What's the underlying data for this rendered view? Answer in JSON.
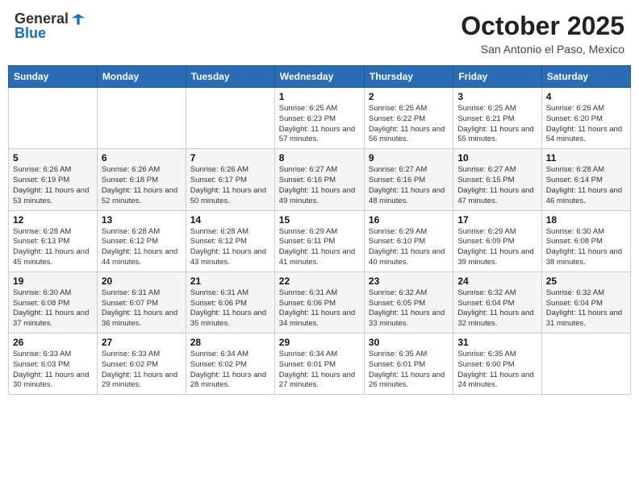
{
  "header": {
    "logo_general": "General",
    "logo_blue": "Blue",
    "month_title": "October 2025",
    "location": "San Antonio el Paso, Mexico"
  },
  "days_of_week": [
    "Sunday",
    "Monday",
    "Tuesday",
    "Wednesday",
    "Thursday",
    "Friday",
    "Saturday"
  ],
  "weeks": [
    [
      {
        "day": "",
        "info": ""
      },
      {
        "day": "",
        "info": ""
      },
      {
        "day": "",
        "info": ""
      },
      {
        "day": "1",
        "info": "Sunrise: 6:25 AM\nSunset: 6:23 PM\nDaylight: 11 hours and 57 minutes."
      },
      {
        "day": "2",
        "info": "Sunrise: 6:25 AM\nSunset: 6:22 PM\nDaylight: 11 hours and 56 minutes."
      },
      {
        "day": "3",
        "info": "Sunrise: 6:25 AM\nSunset: 6:21 PM\nDaylight: 11 hours and 55 minutes."
      },
      {
        "day": "4",
        "info": "Sunrise: 6:26 AM\nSunset: 6:20 PM\nDaylight: 11 hours and 54 minutes."
      }
    ],
    [
      {
        "day": "5",
        "info": "Sunrise: 6:26 AM\nSunset: 6:19 PM\nDaylight: 11 hours and 53 minutes."
      },
      {
        "day": "6",
        "info": "Sunrise: 6:26 AM\nSunset: 6:18 PM\nDaylight: 11 hours and 52 minutes."
      },
      {
        "day": "7",
        "info": "Sunrise: 6:26 AM\nSunset: 6:17 PM\nDaylight: 11 hours and 50 minutes."
      },
      {
        "day": "8",
        "info": "Sunrise: 6:27 AM\nSunset: 6:16 PM\nDaylight: 11 hours and 49 minutes."
      },
      {
        "day": "9",
        "info": "Sunrise: 6:27 AM\nSunset: 6:16 PM\nDaylight: 11 hours and 48 minutes."
      },
      {
        "day": "10",
        "info": "Sunrise: 6:27 AM\nSunset: 6:15 PM\nDaylight: 11 hours and 47 minutes."
      },
      {
        "day": "11",
        "info": "Sunrise: 6:28 AM\nSunset: 6:14 PM\nDaylight: 11 hours and 46 minutes."
      }
    ],
    [
      {
        "day": "12",
        "info": "Sunrise: 6:28 AM\nSunset: 6:13 PM\nDaylight: 11 hours and 45 minutes."
      },
      {
        "day": "13",
        "info": "Sunrise: 6:28 AM\nSunset: 6:12 PM\nDaylight: 11 hours and 44 minutes."
      },
      {
        "day": "14",
        "info": "Sunrise: 6:28 AM\nSunset: 6:12 PM\nDaylight: 11 hours and 43 minutes."
      },
      {
        "day": "15",
        "info": "Sunrise: 6:29 AM\nSunset: 6:11 PM\nDaylight: 11 hours and 41 minutes."
      },
      {
        "day": "16",
        "info": "Sunrise: 6:29 AM\nSunset: 6:10 PM\nDaylight: 11 hours and 40 minutes."
      },
      {
        "day": "17",
        "info": "Sunrise: 6:29 AM\nSunset: 6:09 PM\nDaylight: 11 hours and 39 minutes."
      },
      {
        "day": "18",
        "info": "Sunrise: 6:30 AM\nSunset: 6:08 PM\nDaylight: 11 hours and 38 minutes."
      }
    ],
    [
      {
        "day": "19",
        "info": "Sunrise: 6:30 AM\nSunset: 6:08 PM\nDaylight: 11 hours and 37 minutes."
      },
      {
        "day": "20",
        "info": "Sunrise: 6:31 AM\nSunset: 6:07 PM\nDaylight: 11 hours and 36 minutes."
      },
      {
        "day": "21",
        "info": "Sunrise: 6:31 AM\nSunset: 6:06 PM\nDaylight: 11 hours and 35 minutes."
      },
      {
        "day": "22",
        "info": "Sunrise: 6:31 AM\nSunset: 6:06 PM\nDaylight: 11 hours and 34 minutes."
      },
      {
        "day": "23",
        "info": "Sunrise: 6:32 AM\nSunset: 6:05 PM\nDaylight: 11 hours and 33 minutes."
      },
      {
        "day": "24",
        "info": "Sunrise: 6:32 AM\nSunset: 6:04 PM\nDaylight: 11 hours and 32 minutes."
      },
      {
        "day": "25",
        "info": "Sunrise: 6:32 AM\nSunset: 6:04 PM\nDaylight: 11 hours and 31 minutes."
      }
    ],
    [
      {
        "day": "26",
        "info": "Sunrise: 6:33 AM\nSunset: 6:03 PM\nDaylight: 11 hours and 30 minutes."
      },
      {
        "day": "27",
        "info": "Sunrise: 6:33 AM\nSunset: 6:02 PM\nDaylight: 11 hours and 29 minutes."
      },
      {
        "day": "28",
        "info": "Sunrise: 6:34 AM\nSunset: 6:02 PM\nDaylight: 11 hours and 28 minutes."
      },
      {
        "day": "29",
        "info": "Sunrise: 6:34 AM\nSunset: 6:01 PM\nDaylight: 11 hours and 27 minutes."
      },
      {
        "day": "30",
        "info": "Sunrise: 6:35 AM\nSunset: 6:01 PM\nDaylight: 11 hours and 26 minutes."
      },
      {
        "day": "31",
        "info": "Sunrise: 6:35 AM\nSunset: 6:00 PM\nDaylight: 11 hours and 24 minutes."
      },
      {
        "day": "",
        "info": ""
      }
    ]
  ]
}
